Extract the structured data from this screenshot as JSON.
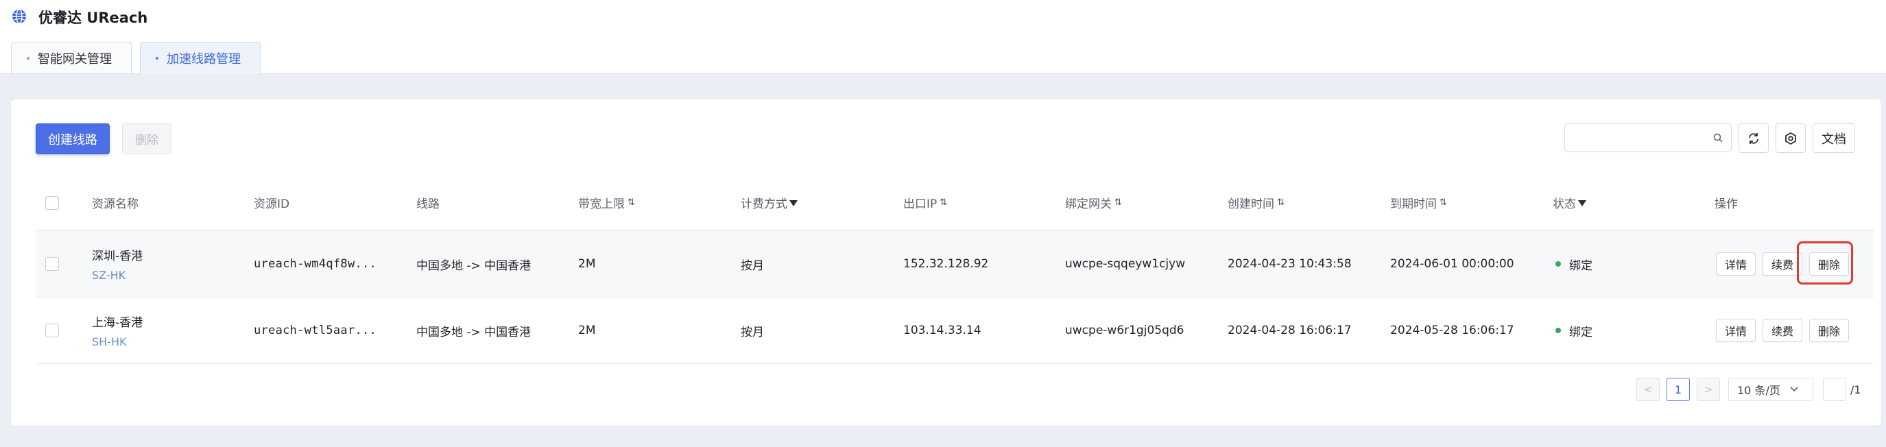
{
  "app": {
    "title": "优睿达 UReach"
  },
  "tabs": [
    {
      "label": "智能网关管理"
    },
    {
      "label": "加速线路管理"
    }
  ],
  "toolbar": {
    "create_label": "创建线路",
    "delete_label": "删除",
    "search_placeholder": "",
    "doc_label": "文档"
  },
  "table": {
    "columns": [
      "资源名称",
      "资源ID",
      "线路",
      "带宽上限",
      "计费方式",
      "出口IP",
      "绑定网关",
      "创建时间",
      "到期时间",
      "状态",
      "操作"
    ],
    "rows": [
      {
        "name": "深圳-香港",
        "code": "SZ-HK",
        "id": "ureach-wm4qf8w...",
        "route": "中国多地 -> 中国香港",
        "bandwidth": "2M",
        "billing": "按月",
        "ip": "152.32.128.92",
        "gateway": "uwcpe-sqqeyw1cjyw",
        "created": "2024-04-23 10:43:58",
        "expires": "2024-06-01 00:00:00",
        "status": "绑定",
        "actions": [
          "详情",
          "续费",
          "删除"
        ]
      },
      {
        "name": "上海-香港",
        "code": "SH-HK",
        "id": "ureach-wtl5aar...",
        "route": "中国多地 -> 中国香港",
        "bandwidth": "2M",
        "billing": "按月",
        "ip": "103.14.33.14",
        "gateway": "uwcpe-w6r1gj05qd6",
        "created": "2024-04-28 16:06:17",
        "expires": "2024-05-28 16:06:17",
        "status": "绑定",
        "actions": [
          "详情",
          "续费",
          "删除"
        ]
      }
    ]
  },
  "pagination": {
    "prev": "<",
    "current": "1",
    "next": ">",
    "page_size": "10 条/页",
    "total": "/1"
  },
  "colors": {
    "primary": "#4d6fe6",
    "status_ok": "#3ca55c",
    "highlight": "#e23a2f"
  },
  "icons": [
    "globe-logo-icon",
    "search-icon",
    "refresh-icon",
    "settings-icon",
    "sort-icon",
    "filter-icon",
    "chevron-down-icon"
  ]
}
